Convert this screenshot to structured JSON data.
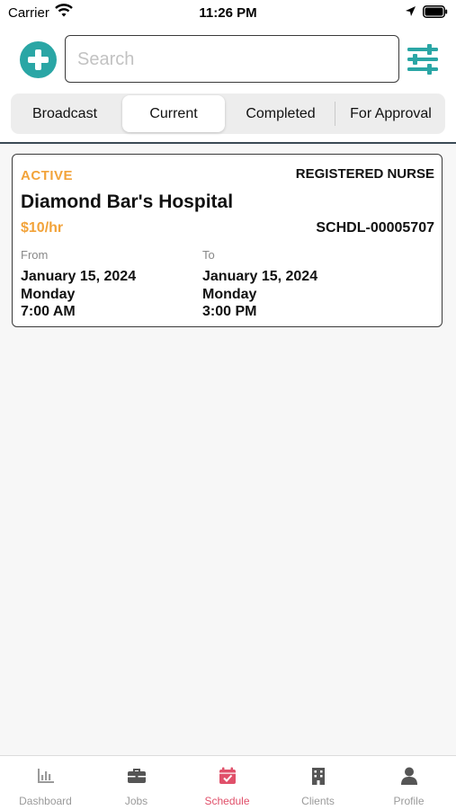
{
  "status_bar": {
    "carrier": "Carrier",
    "time": "11:26 PM"
  },
  "search": {
    "placeholder": "Search"
  },
  "tabs": [
    {
      "label": "Broadcast"
    },
    {
      "label": "Current"
    },
    {
      "label": "Completed"
    },
    {
      "label": "For Approval"
    }
  ],
  "active_tab": "Current",
  "card": {
    "status": "ACTIVE",
    "role": "REGISTERED NURSE",
    "hospital": "Diamond Bar's Hospital",
    "rate": "$10/hr",
    "schedule_id": "SCHDL-00005707",
    "from_label": "From",
    "to_label": "To",
    "from_date": "January 15, 2024",
    "from_day": "Monday",
    "from_time": "7:00 AM",
    "to_date": "January 15, 2024",
    "to_day": "Monday",
    "to_time": "3:00 PM"
  },
  "bottom_nav": [
    {
      "label": "Dashboard",
      "icon": "bar-chart-icon"
    },
    {
      "label": "Jobs",
      "icon": "briefcase-icon"
    },
    {
      "label": "Schedule",
      "icon": "calendar-check-icon"
    },
    {
      "label": "Clients",
      "icon": "building-icon"
    },
    {
      "label": "Profile",
      "icon": "person-icon"
    }
  ],
  "active_nav": "Schedule",
  "colors": {
    "accent_teal": "#2aa6a5",
    "status_orange": "#f2a33a",
    "active_nav_pink": "#e0506a",
    "inactive_nav_gray": "#9a9a9a"
  }
}
